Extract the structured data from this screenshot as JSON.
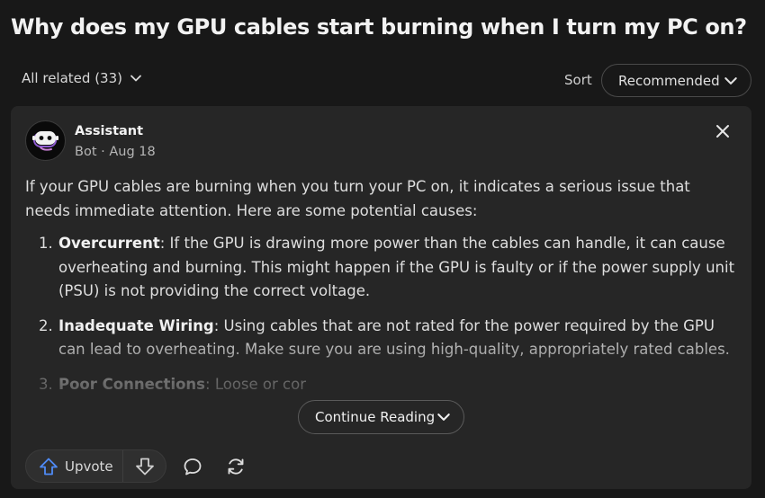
{
  "question": {
    "title": "Why does my GPU cables start burning when I turn my PC on?"
  },
  "filter": {
    "label": "All related (33)",
    "icon": "chevron-down-icon"
  },
  "sort": {
    "label": "Sort",
    "selected": "Recommended",
    "icon": "chevron-down-icon"
  },
  "answer": {
    "author": "Assistant",
    "meta": "Bot · Aug 18",
    "intro": "If your GPU cables are burning when you turn your PC on, it indicates a serious issue that needs immediate attention. Here are some potential causes:",
    "items": [
      {
        "num": "1.",
        "title": "Overcurrent",
        "text": ": If the GPU is drawing more power than the cables can handle, it can cause overheating and burning. This might happen if the GPU is faulty or if the power supply unit (PSU) is not providing the correct voltage."
      },
      {
        "num": "2.",
        "title": "Inadequate Wiring",
        "text": ": Using cables that are not rated for the power required by the GPU can lead to overheating. Make sure you are using high-quality, appropriately rated cables."
      },
      {
        "num": "3.",
        "title": "Poor Connections",
        "text": ": Loose or cor"
      }
    ],
    "continue_label": "Continue Reading",
    "upvote_label": "Upvote"
  },
  "colors": {
    "accent_blue": "#4f8bf7",
    "background": "#181818",
    "card": "#262626"
  }
}
